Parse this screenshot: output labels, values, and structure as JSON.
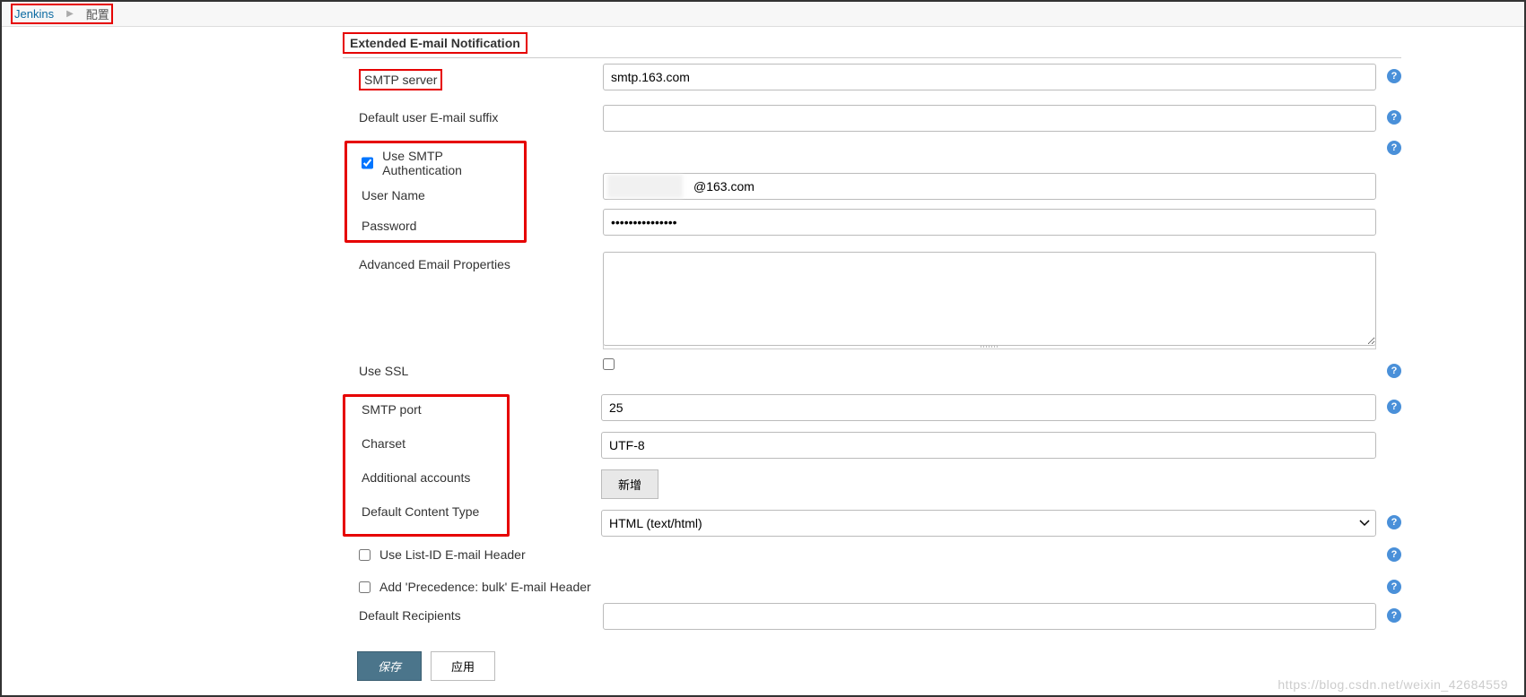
{
  "breadcrumb": {
    "root": "Jenkins",
    "current": "配置"
  },
  "section": {
    "title": "Extended E-mail Notification"
  },
  "labels": {
    "smtpServer": "SMTP server",
    "defaultSuffix": "Default user E-mail suffix",
    "useSmtpAuth": "Use SMTP Authentication",
    "userName": "User Name",
    "password": "Password",
    "advancedProps": "Advanced Email Properties",
    "useSsl": "Use SSL",
    "smtpPort": "SMTP port",
    "charset": "Charset",
    "additionalAccounts": "Additional accounts",
    "defaultContentType": "Default Content Type",
    "useListId": "Use List-ID E-mail Header",
    "addPrecedence": "Add 'Precedence: bulk' E-mail Header",
    "defaultRecipients": "Default Recipients"
  },
  "values": {
    "smtpServer": "smtp.163.com",
    "defaultSuffix": "",
    "useSmtpAuth": true,
    "userName": "@163.com",
    "password": "•••••••••••••••",
    "advancedProps": "",
    "useSsl": false,
    "smtpPort": "25",
    "charset": "UTF-8",
    "defaultContentType": "HTML (text/html)",
    "useListId": false,
    "addPrecedence": false,
    "defaultRecipients": ""
  },
  "buttons": {
    "add": "新增",
    "save": "保存",
    "apply": "应用"
  },
  "watermark": "https://blog.csdn.net/weixin_42684559"
}
